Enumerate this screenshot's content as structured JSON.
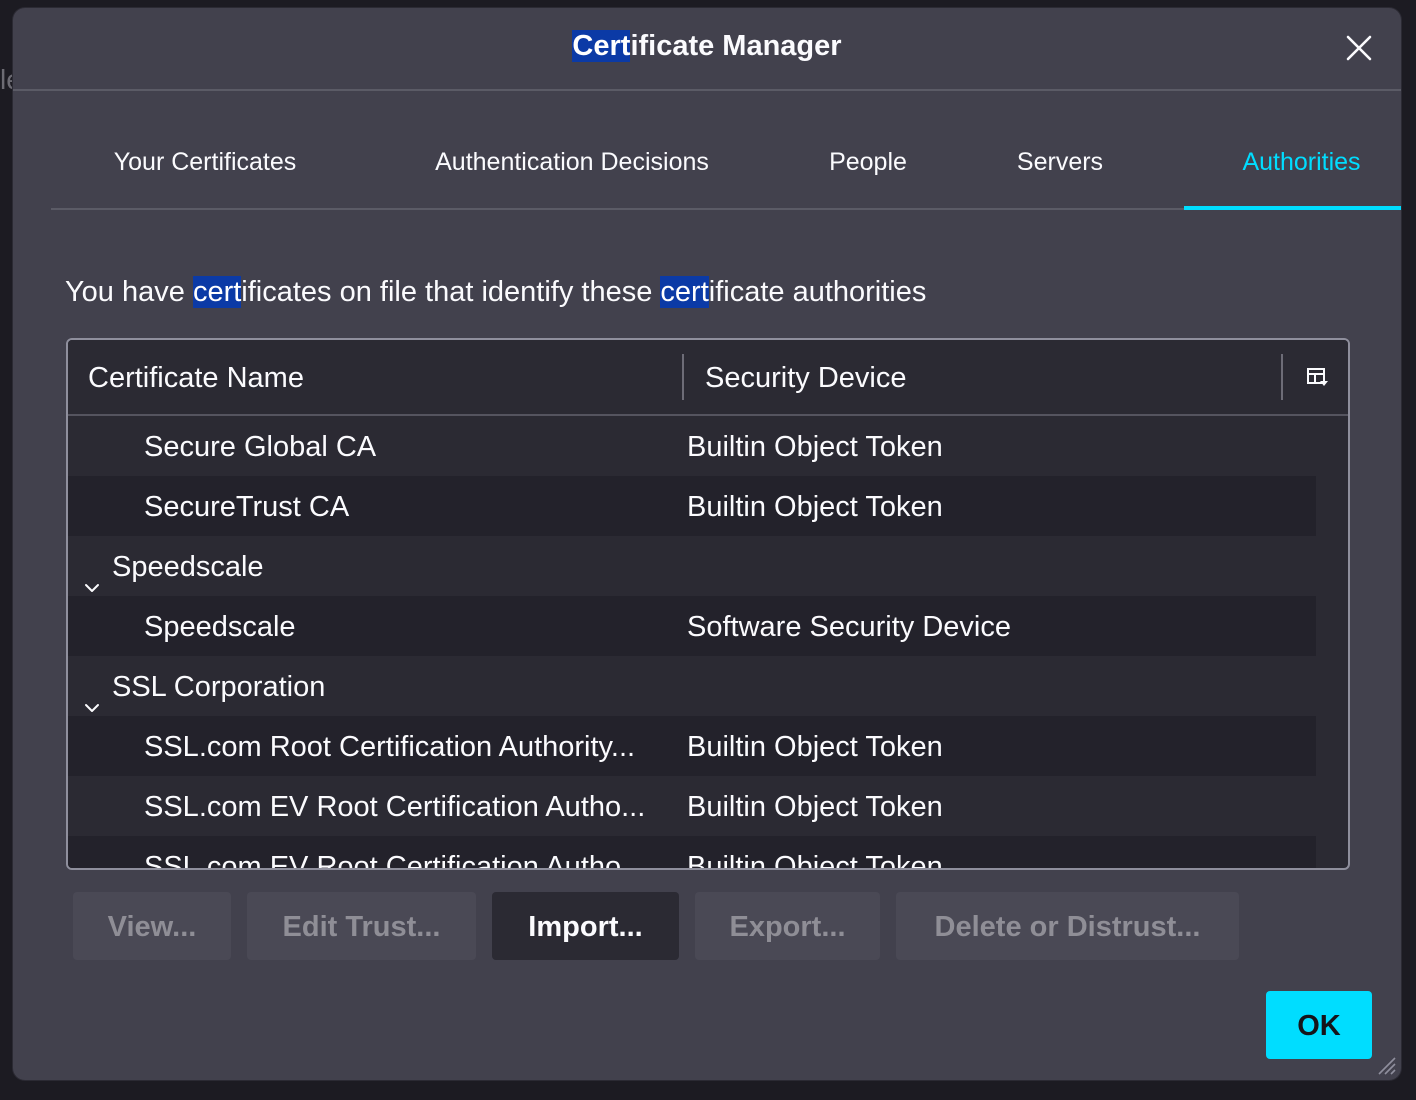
{
  "dialog": {
    "title_highlight": "Cert",
    "title_rest": "ificate Manager"
  },
  "tabs": [
    {
      "label": "Your Certificates"
    },
    {
      "label": "Authentication Decisions"
    },
    {
      "label": "People"
    },
    {
      "label": "Servers"
    },
    {
      "label": "Authorities",
      "active": true
    }
  ],
  "description": {
    "part1": "You have ",
    "hl1": "cert",
    "part2": "ificates on file that identify these ",
    "hl2": "cert",
    "part3": "ificate authorities"
  },
  "tree": {
    "columns": {
      "name": "Certificate Name",
      "device": "Security Device"
    },
    "rows": [
      {
        "name": "Secure Global CA",
        "device": "Builtin Object Token"
      },
      {
        "name": "SecureTrust CA",
        "device": "Builtin Object Token"
      },
      {
        "name": "Speedscale",
        "device": "",
        "group": true
      },
      {
        "name": "Speedscale",
        "device": "Software Security Device"
      },
      {
        "name": "SSL Corporation",
        "device": "",
        "group": true
      },
      {
        "name": "SSL.com Root Certification Authority...",
        "device": "Builtin Object Token"
      },
      {
        "name": "SSL.com EV Root Certification Autho...",
        "device": "Builtin Object Token"
      },
      {
        "name": "SSL.com EV Root Certification Autho...",
        "device": "Builtin Object Token"
      }
    ]
  },
  "buttons": {
    "view": "View...",
    "edit_trust": "Edit Trust...",
    "import": "Import...",
    "export": "Export...",
    "delete": "Delete or Distrust...",
    "ok": "OK"
  },
  "colors": {
    "accent": "#00ddff",
    "dialog_bg": "#42414d",
    "highlight": "#0b3aa6"
  }
}
